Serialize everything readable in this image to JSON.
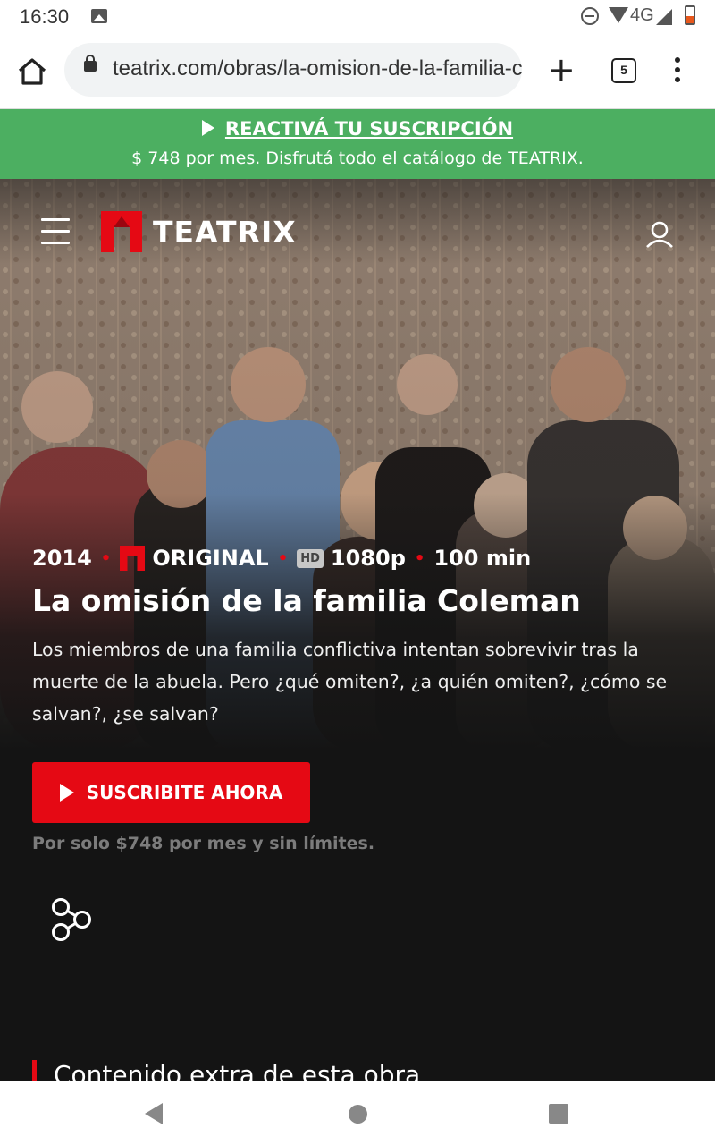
{
  "status_bar": {
    "time": "16:30",
    "network": "4G"
  },
  "browser": {
    "url": "teatrix.com/obras/la-omision-de-la-familia-coleman",
    "tab_count": "5",
    "new_tab_glyph": "+"
  },
  "promo": {
    "link_label": "REACTIVÁ TU SUSCRIPCIÓN",
    "subtitle": "$ 748 por mes. Disfrutá todo el catálogo de TEATRIX."
  },
  "header": {
    "logo_text": "TEATRIX"
  },
  "show": {
    "year": "2014",
    "badge": "ORIGINAL",
    "hd_label": "HD",
    "quality": "1080p",
    "duration": "100 min",
    "title": "La omisión de la familia Coleman",
    "description": "Los miembros de una familia conflictiva intentan sobrevivir tras la muerte de la abuela. Pero ¿qué omiten?, ¿a quién omiten?, ¿cómo se salvan?, ¿se salvan?",
    "cta_label": "SUSCRIBITE AHORA",
    "cta_note": "Por solo $748 por mes y sin límites.",
    "extra_heading": "Contenido extra de esta obra"
  },
  "colors": {
    "brand_red": "#e50914",
    "promo_green": "#4caf61",
    "background": "#141414"
  },
  "icons": [
    "home-icon",
    "lock-icon",
    "tab-switcher-icon",
    "menu-icon",
    "hamburger-icon",
    "user-icon",
    "share-icon",
    "play-icon"
  ]
}
